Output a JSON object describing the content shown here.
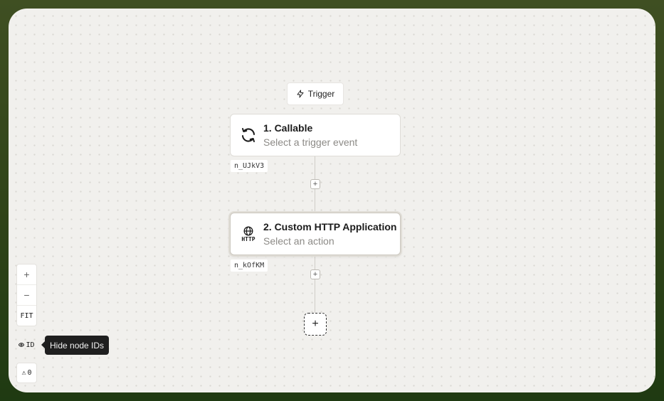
{
  "trigger_chip": {
    "icon": "bolt-icon",
    "label": "Trigger"
  },
  "nodes": [
    {
      "title": "1. Callable",
      "subtitle": "Select a trigger event",
      "icon": "refresh-icon",
      "id_label": "n_UJkV3"
    },
    {
      "title": "2. Custom HTTP Application",
      "subtitle": "Select an action",
      "icon": "globe-http-icon",
      "icon_text": "HTTP",
      "id_label": "n_kOfKM"
    }
  ],
  "connectors": {
    "plus": "+"
  },
  "add_node": {
    "label": "+"
  },
  "zoom_controls": {
    "zoom_in": "+",
    "zoom_out": "−",
    "fit": "FIT"
  },
  "id_toggle": {
    "label": "ID",
    "tooltip": "Hide node IDs"
  },
  "warnings": {
    "symbol": "⚠",
    "count": "0"
  },
  "colors": {
    "frame_border": "#2f4318",
    "canvas": "#f1f0ed",
    "tooltip_bg": "#1f1f1f"
  }
}
